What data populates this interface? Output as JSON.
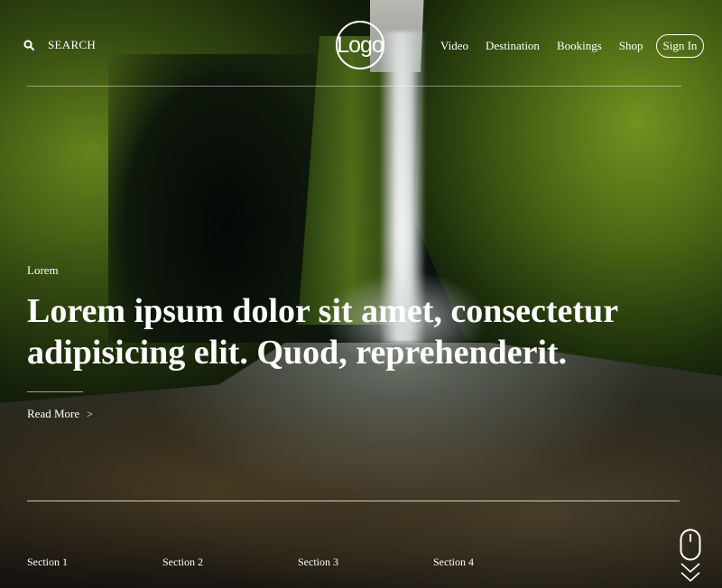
{
  "header": {
    "search_label": "SEARCH",
    "logo_text": "Logo",
    "nav": [
      {
        "label": "Video"
      },
      {
        "label": "Destination"
      },
      {
        "label": "Bookings"
      },
      {
        "label": "Shop"
      }
    ],
    "signin_label": "Sign In"
  },
  "hero": {
    "eyebrow": "Lorem",
    "headline": "Lorem ipsum dolor sit amet, consectetur adipisicing elit. Quod, reprehenderit.",
    "read_more": "Read More",
    "read_more_chevron": ">"
  },
  "sections": [
    {
      "label": "Section 1"
    },
    {
      "label": "Section 2"
    },
    {
      "label": "Section 3"
    },
    {
      "label": "Section 4"
    }
  ],
  "icons": {
    "search": "search-icon",
    "mouse": "mouse-icon",
    "scroll_down": "chevron-down-icon"
  },
  "colors": {
    "text": "#ffffff"
  }
}
